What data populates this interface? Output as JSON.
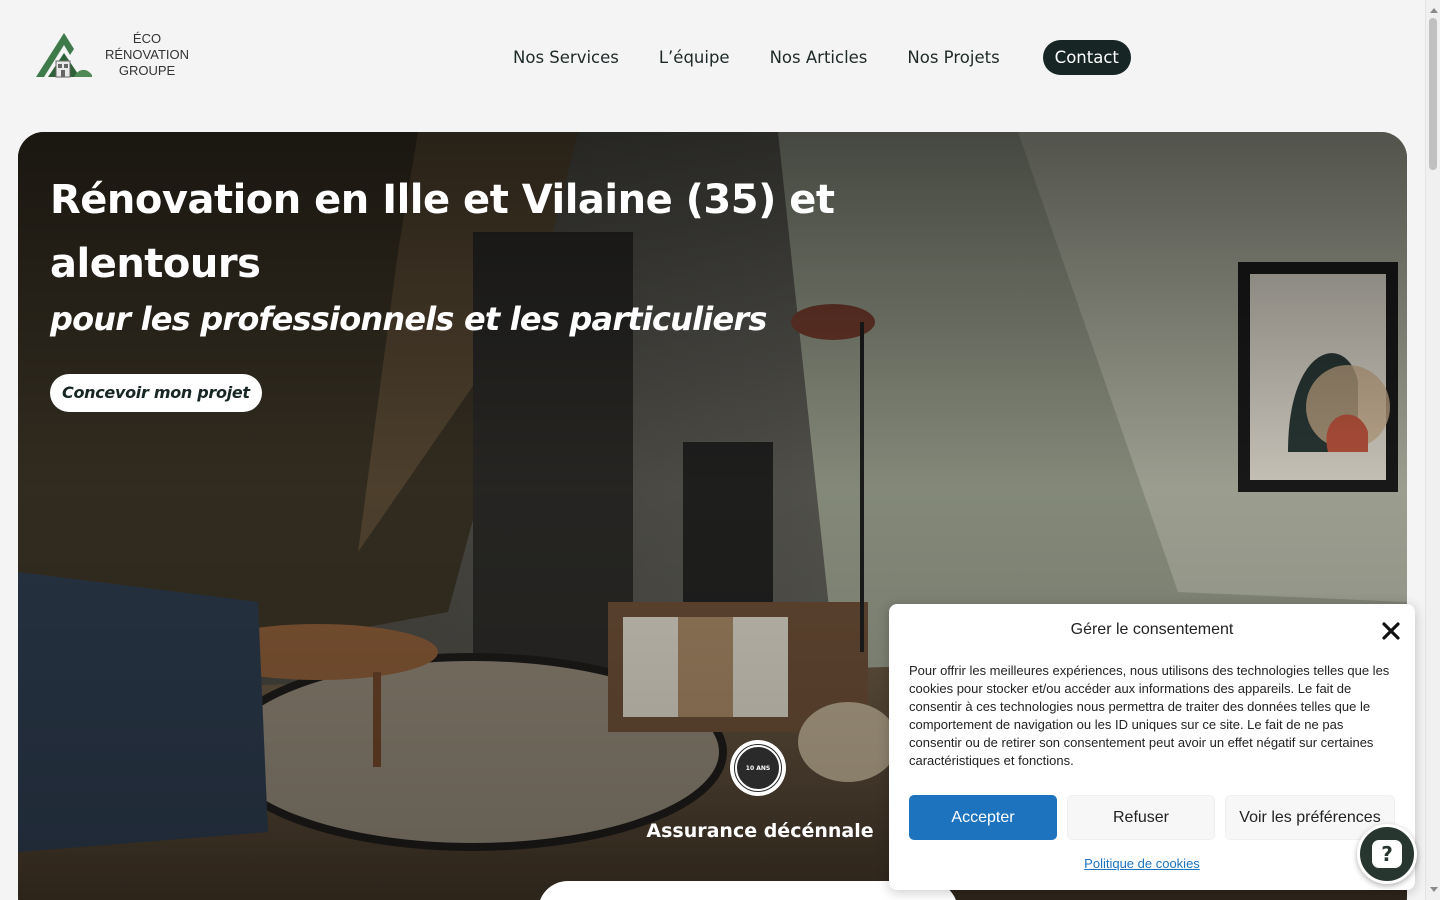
{
  "header": {
    "logo_text_line1": "ÉCO RÉNOVATION",
    "logo_text_line2": "GROUPE",
    "nav": [
      {
        "label": "Nos Services"
      },
      {
        "label": "L’équipe"
      },
      {
        "label": "Nos Articles"
      },
      {
        "label": "Nos Projets"
      }
    ],
    "contact_label": "Contact"
  },
  "hero": {
    "title": "Rénovation en Ille et Vilaine (35) et alentours",
    "subtitle": "pour les professionnels et les particuliers",
    "cta_label": "Concevoir mon projet",
    "badge_text": "10 ANS",
    "badge_label": "Assurance décénnale"
  },
  "consent": {
    "title": "Gérer le consentement",
    "body": "Pour offrir les meilleures expériences, nous utilisons des technologies telles que les cookies pour stocker et/ou accéder aux informations des appareils. Le fait de consentir à ces technologies nous permettra de traiter des données telles que le comportement de navigation ou les ID uniques sur ce site. Le fait de ne pas consentir ou de retirer son consentement peut avoir un effet négatif sur certaines caractéristiques et fonctions.",
    "accept_label": "Accepter",
    "refuse_label": "Refuser",
    "prefs_label": "Voir les préférences",
    "policy_link": "Politique de cookies"
  },
  "help": {
    "icon_glyph": "?"
  },
  "colors": {
    "brand_dark": "#172624",
    "accent_blue": "#1e73be",
    "logo_green": "#3f7a4a"
  }
}
